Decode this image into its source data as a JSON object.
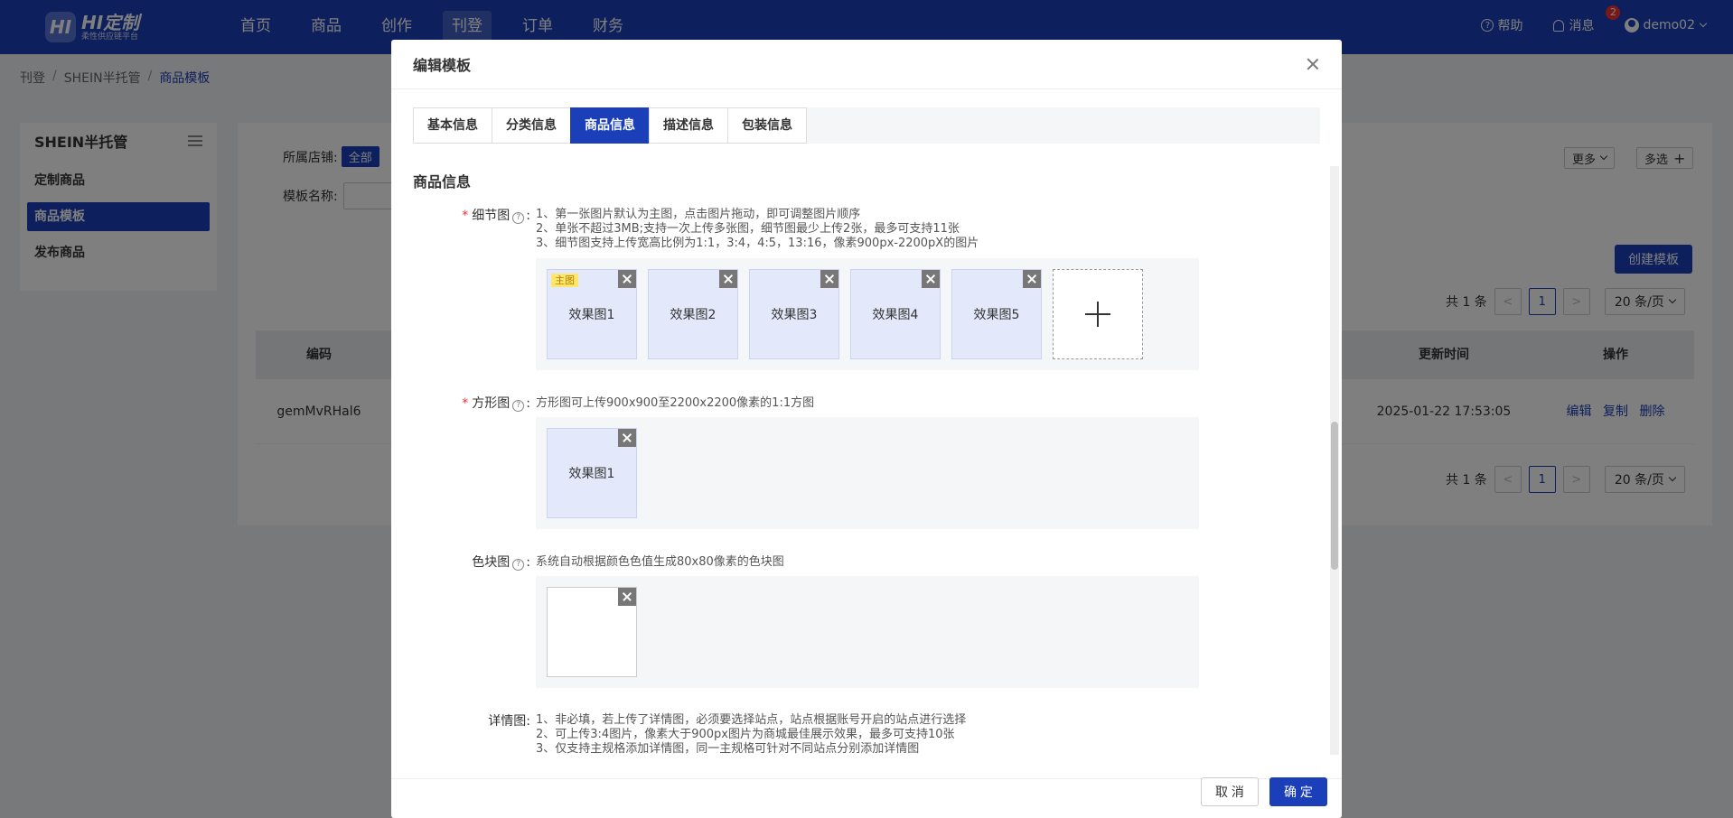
{
  "header": {
    "logo_mark": "HI",
    "logo_title": "HI定制",
    "logo_subtitle": "柔性供应链平台",
    "nav": [
      "首页",
      "商品",
      "创作",
      "刊登",
      "订单",
      "财务"
    ],
    "help": "帮助",
    "messages": "消息",
    "message_count": "2",
    "user": "demo02"
  },
  "breadcrumb": [
    "刊登",
    "SHEIN半托管",
    "商品模板"
  ],
  "sidebar": {
    "title": "SHEIN半托管",
    "items": [
      "定制商品",
      "商品模板",
      "发布商品"
    ]
  },
  "main": {
    "store_label": "所属店铺:",
    "store_value": "全部",
    "template_name_label": "模板名称:",
    "more": "更多",
    "multi_select": "多选",
    "create": "创建模板",
    "total": "共 1 条",
    "page": "1",
    "page_size": "20 条/页",
    "prev": "<",
    "next": ">",
    "columns": {
      "code": "编码",
      "updated": "更新时间",
      "actions": "操作"
    },
    "row": {
      "code": "gemMvRHal6",
      "updated": "2025-01-22 17:53:05",
      "edit": "编辑",
      "copy": "复制",
      "delete": "删除"
    }
  },
  "modal": {
    "title": "编辑模板",
    "tabs": [
      "基本信息",
      "分类信息",
      "商品信息",
      "描述信息",
      "包装信息"
    ],
    "active_tab": "商品信息",
    "section_title": "商品信息",
    "detail": {
      "label": "细节图",
      "hints": [
        "1、第一张图片默认为主图，点击图片拖动，即可调整图片顺序",
        "2、单张不超过3MB;支持一次上传多张图，细节图最少上传2张，最多可支持11张",
        "3、细节图支持上传宽高比例为1:1，3:4，4:5，13:16，像素900px-2200pX的图片"
      ],
      "main_tag": "主图",
      "images": [
        "效果图1",
        "效果图2",
        "效果图3",
        "效果图4",
        "效果图5"
      ]
    },
    "square": {
      "label": "方形图",
      "hint": "方形图可上传900x900至2200x2200像素的1:1方图",
      "images": [
        "效果图1"
      ]
    },
    "swatch": {
      "label": "色块图",
      "hint": "系统自动根据颜色色值生成80x80像素的色块图"
    },
    "details_img": {
      "label": "详情图:",
      "hints": [
        "1、非必填，若上传了详情图，必须要选择站点，站点根据账号开启的站点进行选择",
        "2、可上传3:4图片，像素大于900px图片为商城最佳展示效果，最多可支持10张",
        "3、仅支持主规格添加详情图，同一主规格可针对不同站点分别添加详情图"
      ]
    },
    "cancel": "取 消",
    "confirm": "确 定"
  }
}
